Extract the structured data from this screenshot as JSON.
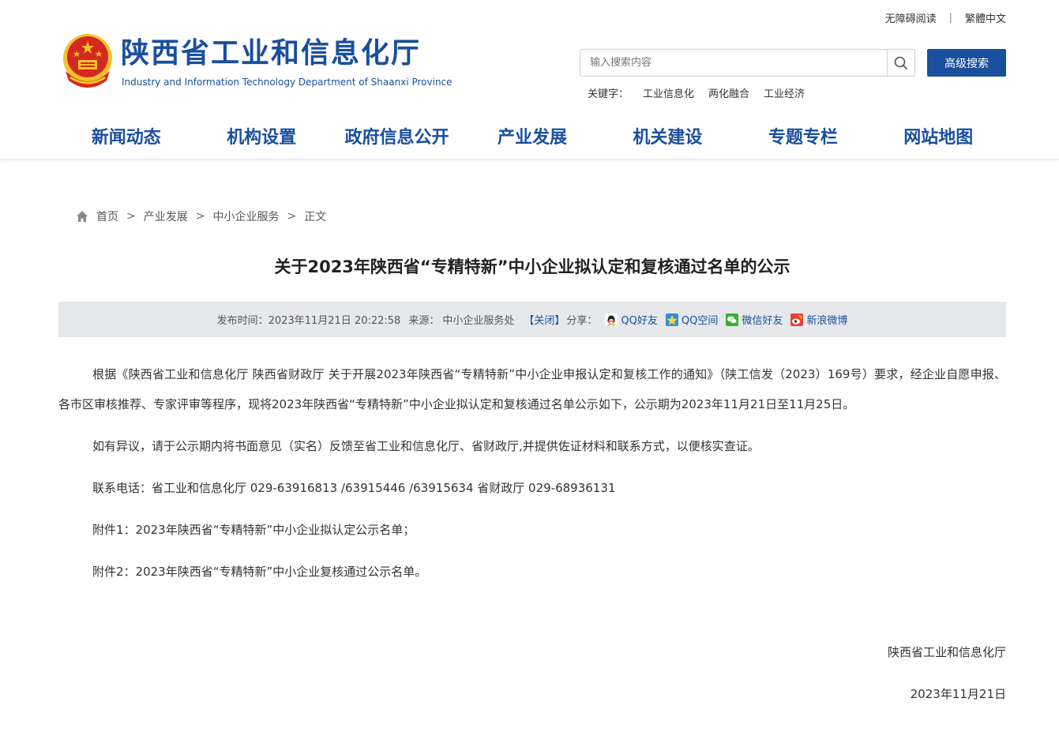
{
  "header": {
    "top_links": {
      "accessibility": "无障碍阅读",
      "traditional": "繁體中文"
    },
    "title": "陕西省工业和信息化厅",
    "subtitle": "Industry and Information Technology Department of Shaanxi Province",
    "search": {
      "placeholder": "输入搜索内容",
      "advanced_label": "高级搜索"
    },
    "keywords": {
      "label": "关键字：",
      "items": [
        "工业信息化",
        "两化融合",
        "工业经济"
      ]
    }
  },
  "nav": {
    "items": [
      "新闻动态",
      "机构设置",
      "政府信息公开",
      "产业发展",
      "机关建设",
      "专题专栏",
      "网站地图"
    ]
  },
  "breadcrumb": {
    "items": [
      "首页",
      "产业发展",
      "中小企业服务",
      "正文"
    ],
    "separator": ">"
  },
  "article": {
    "title": "关于2023年陕西省“专精特新”中小企业拟认定和复核通过名单的公示",
    "meta": {
      "publish_label": "发布时间：",
      "publish_time": "2023年11月21日 20:22:58",
      "source_label": "来源：",
      "source": "中小企业服务处",
      "close_label": "【关闭】",
      "share_label": "分享：",
      "share_items": [
        "QQ好友",
        "QQ空间",
        "微信好友",
        "新浪微博"
      ]
    },
    "paragraphs": [
      "根据《陕西省工业和信息化厅 陕西省财政厅 关于开展2023年陕西省“专精特新”中小企业申报认定和复核工作的通知》（陕工信发（2023）169号）要求，经企业自愿申报、各市区审核推荐、专家评审等程序，现将2023年陕西省“专精特新”中小企业拟认定和复核通过名单公示如下，公示期为2023年11月21日至11月25日。",
      "如有异议，请于公示期内将书面意见（实名）反馈至省工业和信息化厅、省财政厅,并提供佐证材料和联系方式，以便核实查证。",
      "联系电话：省工业和信息化厅  029-63916813 /63915446 /63915634   省财政厅  029-68936131",
      "附件1：2023年陕西省“专精特新”中小企业拟认定公示名单；",
      "附件2：2023年陕西省“专精特新”中小企业复核通过公示名单。"
    ],
    "signature": "陕西省工业和信息化厅",
    "date": "2023年11月21日"
  },
  "colors": {
    "brand_blue": "#1a4f9e",
    "meta_bar_bg": "#e6e8ec",
    "emblem_red": "#d42a1e",
    "emblem_gold": "#f2c230"
  },
  "icons": {
    "logo": "national-emblem-icon",
    "search": "search-icon",
    "home": "home-icon",
    "share": [
      "qq-icon",
      "qzone-icon",
      "wechat-icon",
      "weibo-icon"
    ]
  }
}
